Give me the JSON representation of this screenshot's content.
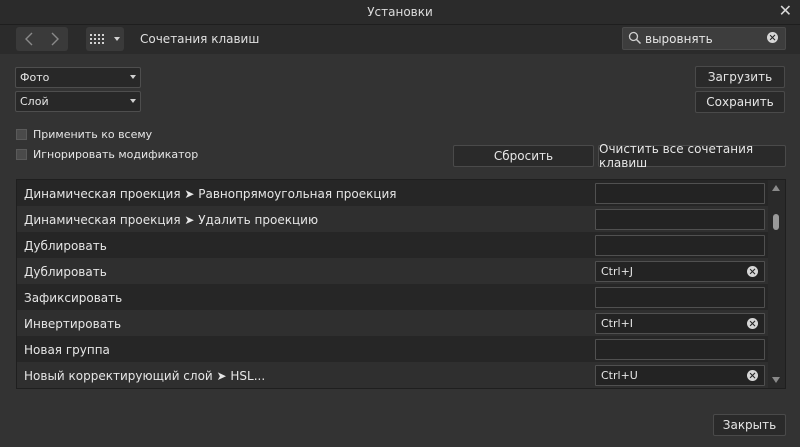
{
  "window": {
    "title": "Установки"
  },
  "toolbar": {
    "breadcrumb": "Сочетания клавиш"
  },
  "search": {
    "value": "выровнять"
  },
  "selectors": {
    "first": "Фото",
    "second": "Слой"
  },
  "buttons": {
    "load": "Загрузить",
    "save": "Сохранить",
    "reset": "Сбросить",
    "clear_all": "Очистить все сочетания клавиш",
    "close": "Закрыть"
  },
  "checks": {
    "apply_all": "Применить ко всему",
    "ignore_modifier": "Игнорировать модификатор"
  },
  "rows": [
    {
      "label": "Динамическая проекция ➤ Равнопрямоугольная проекция",
      "shortcut": ""
    },
    {
      "label": "Динамическая проекция ➤ Удалить проекцию",
      "shortcut": ""
    },
    {
      "label": "Дублировать",
      "shortcut": ""
    },
    {
      "label": "Дублировать",
      "shortcut": "Ctrl+J"
    },
    {
      "label": "Зафиксировать",
      "shortcut": ""
    },
    {
      "label": "Инвертировать",
      "shortcut": "Ctrl+I"
    },
    {
      "label": "Новая группа",
      "shortcut": ""
    },
    {
      "label": "Новый корректирующий слой ➤ HSL...",
      "shortcut": "Ctrl+U"
    }
  ]
}
